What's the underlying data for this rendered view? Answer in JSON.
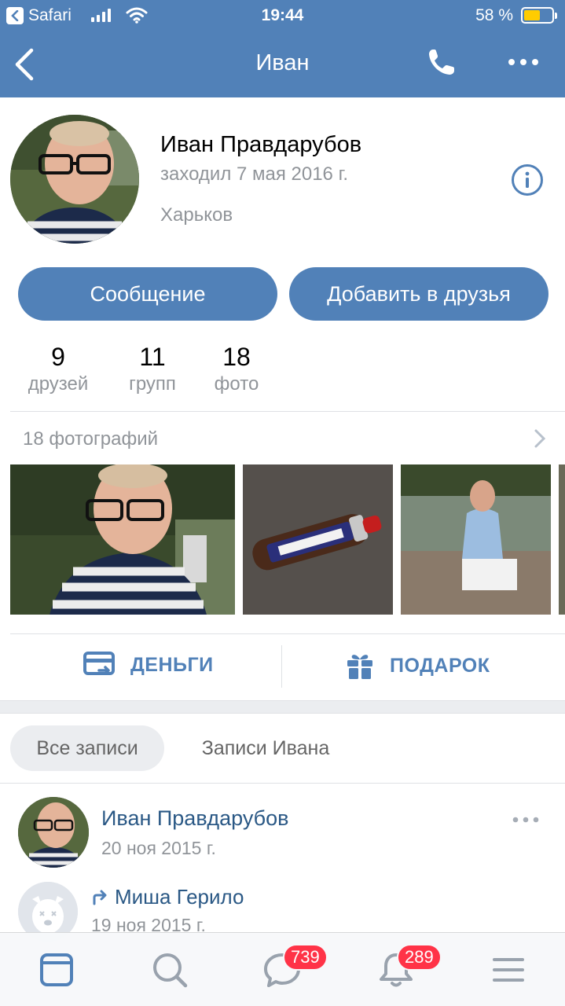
{
  "status_bar": {
    "app": "Safari",
    "time": "19:44",
    "battery": "58 %",
    "battery_level": 0.58
  },
  "nav": {
    "title": "Иван"
  },
  "profile": {
    "name": "Иван Правдарубов",
    "last_seen": "заходил 7 мая 2016 г.",
    "city": "Харьков"
  },
  "buttons": {
    "message": "Сообщение",
    "add_friend": "Добавить в друзья"
  },
  "counters": [
    {
      "num": "9",
      "label": "друзей"
    },
    {
      "num": "11",
      "label": "групп"
    },
    {
      "num": "18",
      "label": "фото"
    }
  ],
  "photos": {
    "header": "18 фотографий"
  },
  "actions": {
    "money": "ДЕНЬГИ",
    "gift": "ПОДАРОК"
  },
  "wall_tabs": {
    "all": "Все записи",
    "own": "Записи Ивана"
  },
  "post": {
    "author": "Иван Правдарубов",
    "date": "20 ноя 2015 г.",
    "repost_author": "Миша Герило",
    "repost_date": "19 ноя 2015 г."
  },
  "tabbar": {
    "messages_badge": "739",
    "notifications_badge": "289"
  },
  "colors": {
    "brand": "#5181b8",
    "link": "#2a5885",
    "badge": "#ff3347",
    "muted": "#909499"
  }
}
